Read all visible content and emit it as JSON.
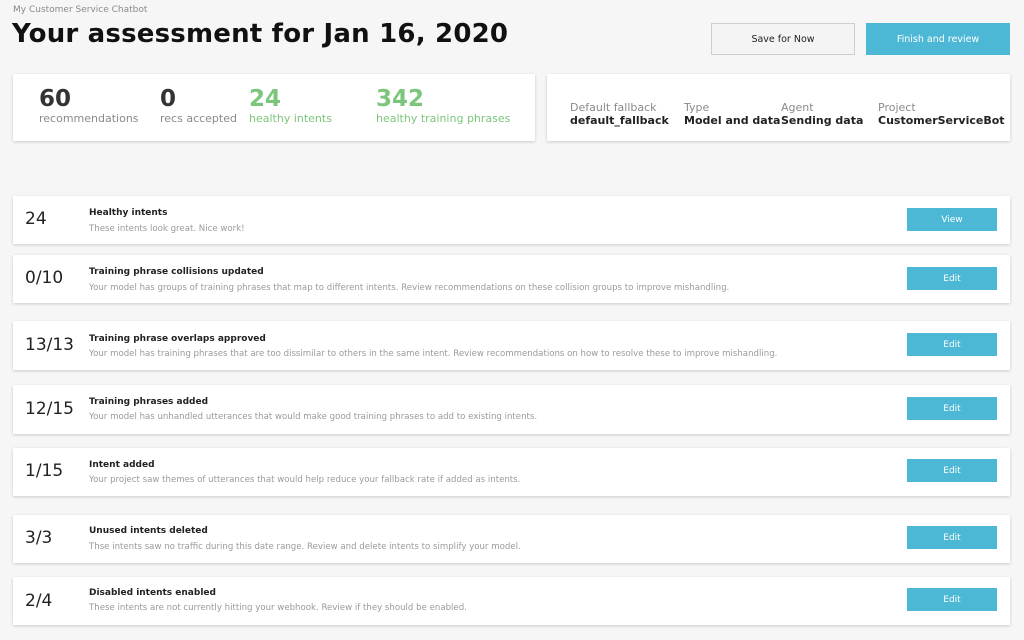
{
  "header": {
    "breadcrumb": "My Customer Service Chatbot",
    "title": "Your assessment for Jan 16, 2020",
    "save_label": "Save for Now",
    "finish_label": "Finish and review"
  },
  "stats": [
    {
      "value": "60",
      "label": "recommendations"
    },
    {
      "value": "0",
      "label": "recs accepted"
    },
    {
      "value": "24",
      "label": "healthy intents"
    },
    {
      "value": "342",
      "label": "healthy training phrases"
    }
  ],
  "meta": [
    {
      "label": "Default fallback",
      "value": "default_fallback"
    },
    {
      "label": "Type",
      "value": "Model and data"
    },
    {
      "label": "Agent",
      "value": "Sending data"
    },
    {
      "label": "Project",
      "value": "CustomerServiceBot"
    }
  ],
  "rows": [
    {
      "count": "24",
      "title": "Healthy intents",
      "desc": "These intents look great. Nice work!",
      "action": "View"
    },
    {
      "count": "0/10",
      "title": "Training phrase collisions updated",
      "desc": "Your model has groups of training phrases that map to different intents. Review recommendations on these collision groups to improve mishandling.",
      "action": "Edit"
    },
    {
      "count": "13/13",
      "title": "Training phrase overlaps approved",
      "desc": "Your model has training phrases that are too dissimilar to others in the same intent. Review recommendations on how to resolve these to improve mishandling.",
      "action": "Edit"
    },
    {
      "count": "12/15",
      "title": "Training phrases added",
      "desc": "Your model has unhandled utterances that would make good training phrases to add to existing intents.",
      "action": "Edit"
    },
    {
      "count": "1/15",
      "title": "Intent added",
      "desc": "Your project saw themes of utterances that would help reduce your fallback rate if added as intents.",
      "action": "Edit"
    },
    {
      "count": "3/3",
      "title": "Unused intents deleted",
      "desc": "Thse intents saw no traffic during this date range. Review and delete intents to simplify your model.",
      "action": "Edit"
    },
    {
      "count": "2/4",
      "title": "Disabled intents enabled",
      "desc": "These intents are not currently hitting your webhook. Review if they should be enabled.",
      "action": "Edit"
    }
  ],
  "colors": {
    "accent": "#4db8d6",
    "healthy": "#7cc67c"
  }
}
